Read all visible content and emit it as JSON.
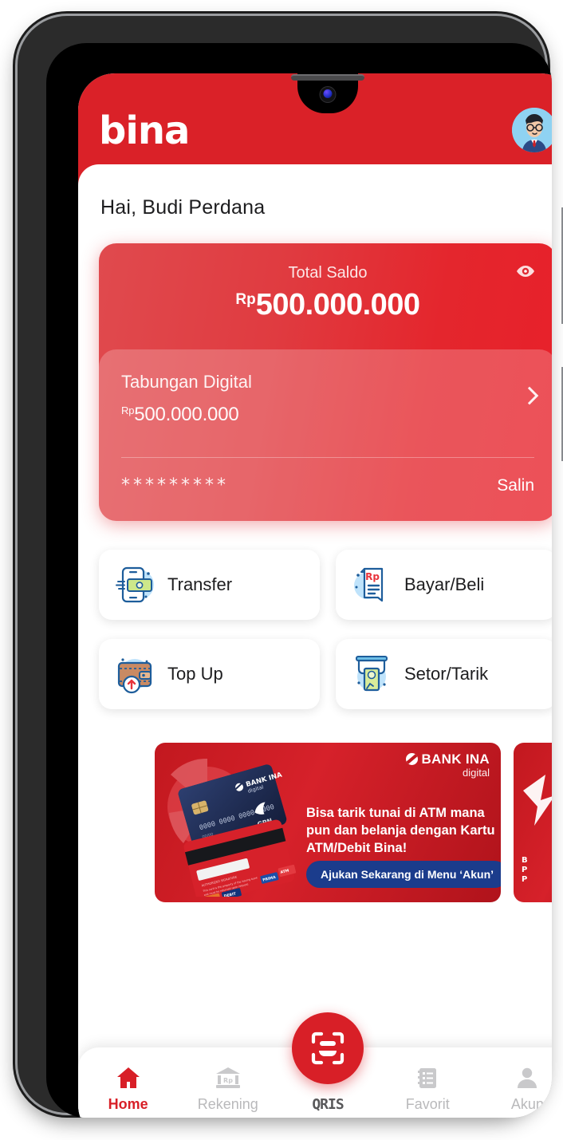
{
  "app": {
    "brand": "bina",
    "header_color": "#DA2128",
    "accent_color": "#D81F27"
  },
  "header": {
    "logo_text": "bina",
    "avatar_label": "Budi Perdana"
  },
  "greeting": {
    "text": "Hai, Budi Perdana"
  },
  "balance_card": {
    "total_label": "Total Saldo",
    "currency_symbol": "Rp",
    "total_amount": "500.000.000",
    "visibility_icon": "eye-icon",
    "account_name": "Tabungan Digital",
    "account_currency": "Rp",
    "account_amount": "500.000.000",
    "account_number_masked": "*********",
    "copy_label": "Salin",
    "chevron_icon": "chevron-right-icon"
  },
  "quick_actions": [
    {
      "label": "Transfer",
      "icon": "transfer-icon"
    },
    {
      "label": "Bayar/Beli",
      "icon": "bill-payment-icon"
    },
    {
      "label": "Top Up",
      "icon": "wallet-topup-icon"
    },
    {
      "label": "Setor/Tarik",
      "icon": "atm-cash-icon"
    }
  ],
  "banner": {
    "bank_name": "BANK INA",
    "bank_sub": "digital",
    "headline": "Bisa tarik tunai di ATM mana pun dan belanja dengan Kartu ATM/Debit Bina!",
    "cta_label": "Ajukan Sekarang di Menu ‘Akun’",
    "cta_color": "#1B3C8C",
    "background_color": "#C2181F"
  },
  "bottom_nav": {
    "items": [
      {
        "label": "Home",
        "icon": "home-icon",
        "active": true
      },
      {
        "label": "Rekening",
        "icon": "bank-icon",
        "active": false
      },
      {
        "label": "QRIS",
        "icon": "qr-scan-icon",
        "active": false
      },
      {
        "label": "Favorit",
        "icon": "list-icon",
        "active": false
      },
      {
        "label": "Akun",
        "icon": "person-icon",
        "active": false
      }
    ]
  }
}
